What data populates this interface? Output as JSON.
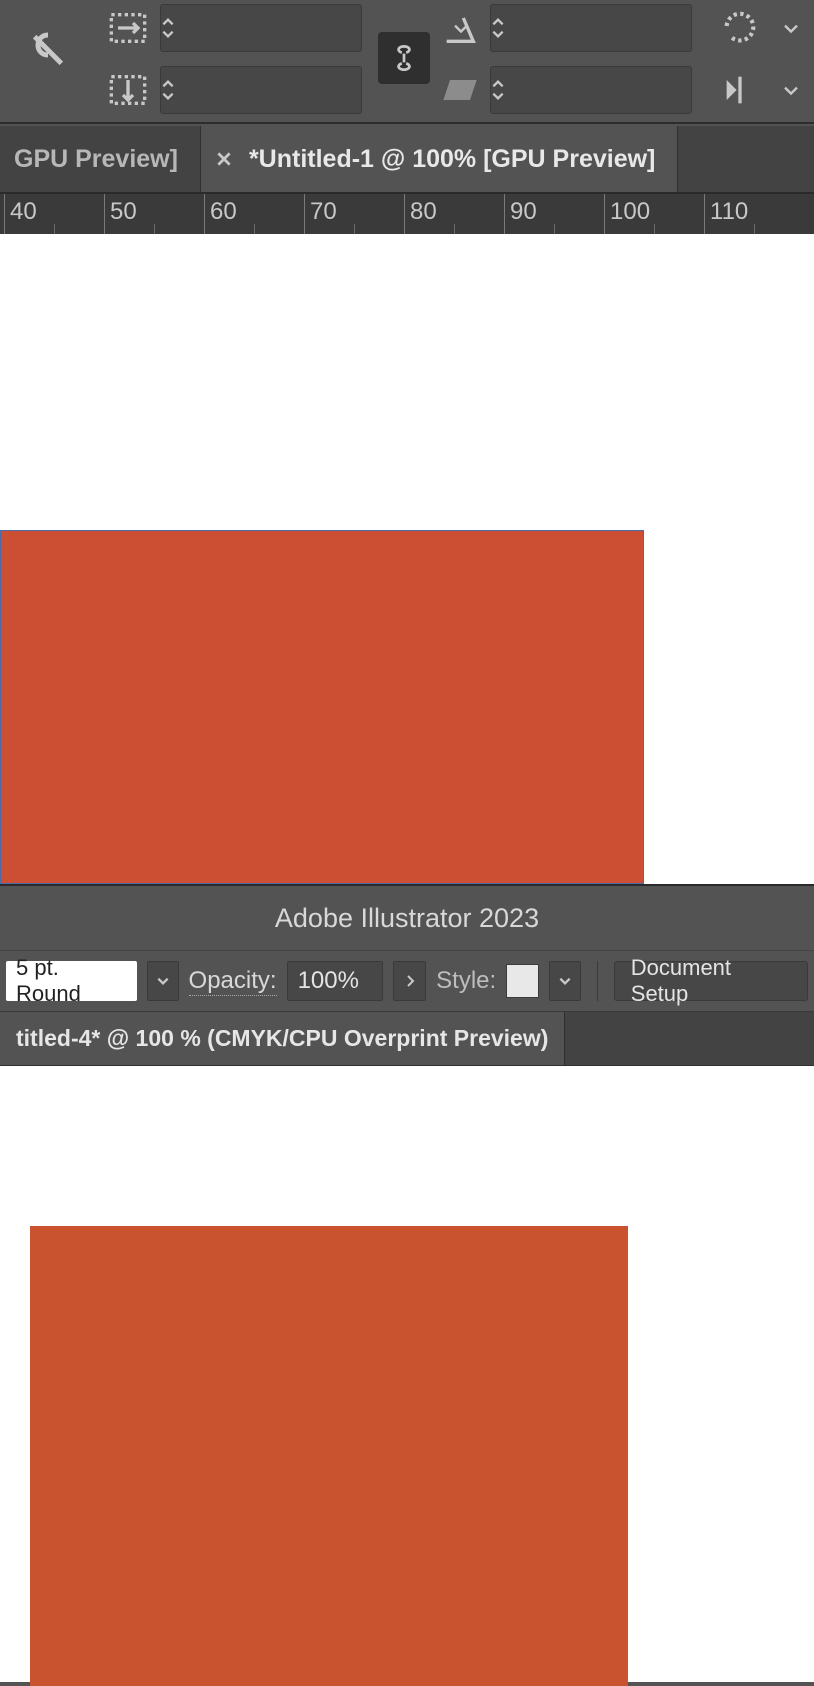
{
  "top_controlbar": {
    "width_value": "",
    "height_value": "",
    "shear_value": "",
    "skew_value": ""
  },
  "tabs_upper": {
    "inactive_label": "GPU Preview]",
    "active_label": "*Untitled-1 @ 100% [GPU Preview]"
  },
  "ruler": {
    "marks": [
      "40",
      "50",
      "60",
      "70",
      "80",
      "90",
      "100",
      "110"
    ]
  },
  "mid_title": "Adobe Illustrator 2023",
  "mid_controls": {
    "brush_label": "5 pt. Round",
    "opacity_label": "Opacity:",
    "opacity_value": "100%",
    "style_label": "Style:",
    "doc_setup_label": "Document Setup"
  },
  "tabs_lower": {
    "active_label": "titled-4* @ 100 % (CMYK/CPU Overprint Preview)"
  },
  "colors": {
    "shape": "#cd4f33"
  }
}
